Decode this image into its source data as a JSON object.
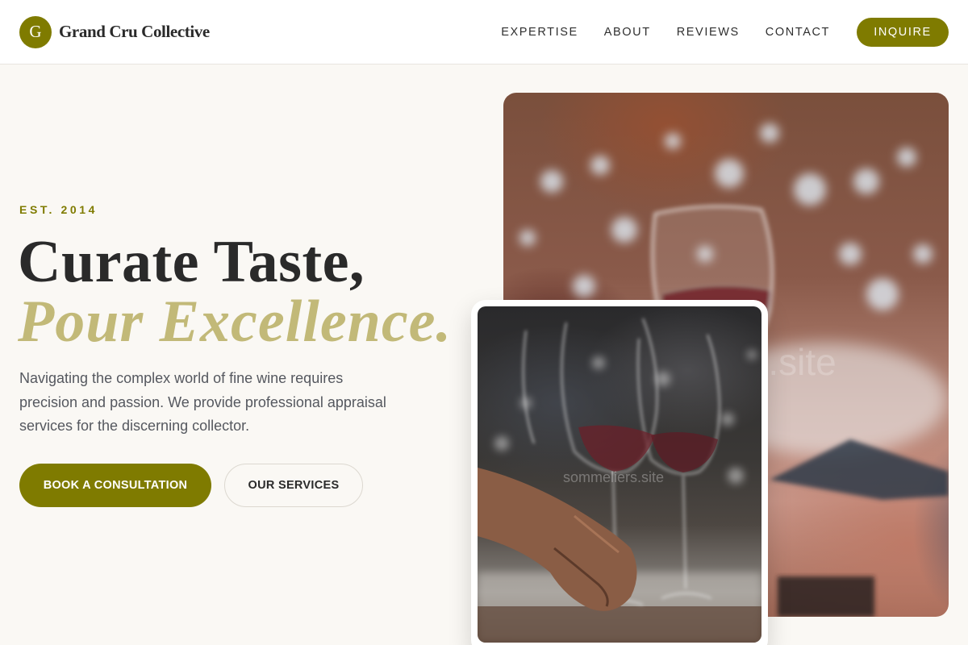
{
  "brand": {
    "logo_letter": "G",
    "name": "Grand Cru Collective",
    "accent_color": "#7f7b00"
  },
  "nav": {
    "links": [
      "EXPERTISE",
      "ABOUT",
      "REVIEWS",
      "CONTACT"
    ],
    "cta_label": "INQUIRE"
  },
  "hero": {
    "eyebrow": "EST. 2014",
    "headline_line1": "Curate Taste,",
    "headline_line2": "Pour Excellence.",
    "headline_accent_color": "#c2b978",
    "intro": "Navigating the complex world of fine wine requires precision and passion. We provide professional appraisal services for the discerning collector.",
    "primary_button": "BOOK A CONSULTATION",
    "secondary_button": "OUR SERVICES"
  },
  "images": {
    "main_photo": "wine-glasses-bokeh-photo",
    "inset_photo": "hand-holding-wine-glass-photo",
    "watermark_main": "rs.site",
    "watermark_inset": "sommeliers.site"
  }
}
